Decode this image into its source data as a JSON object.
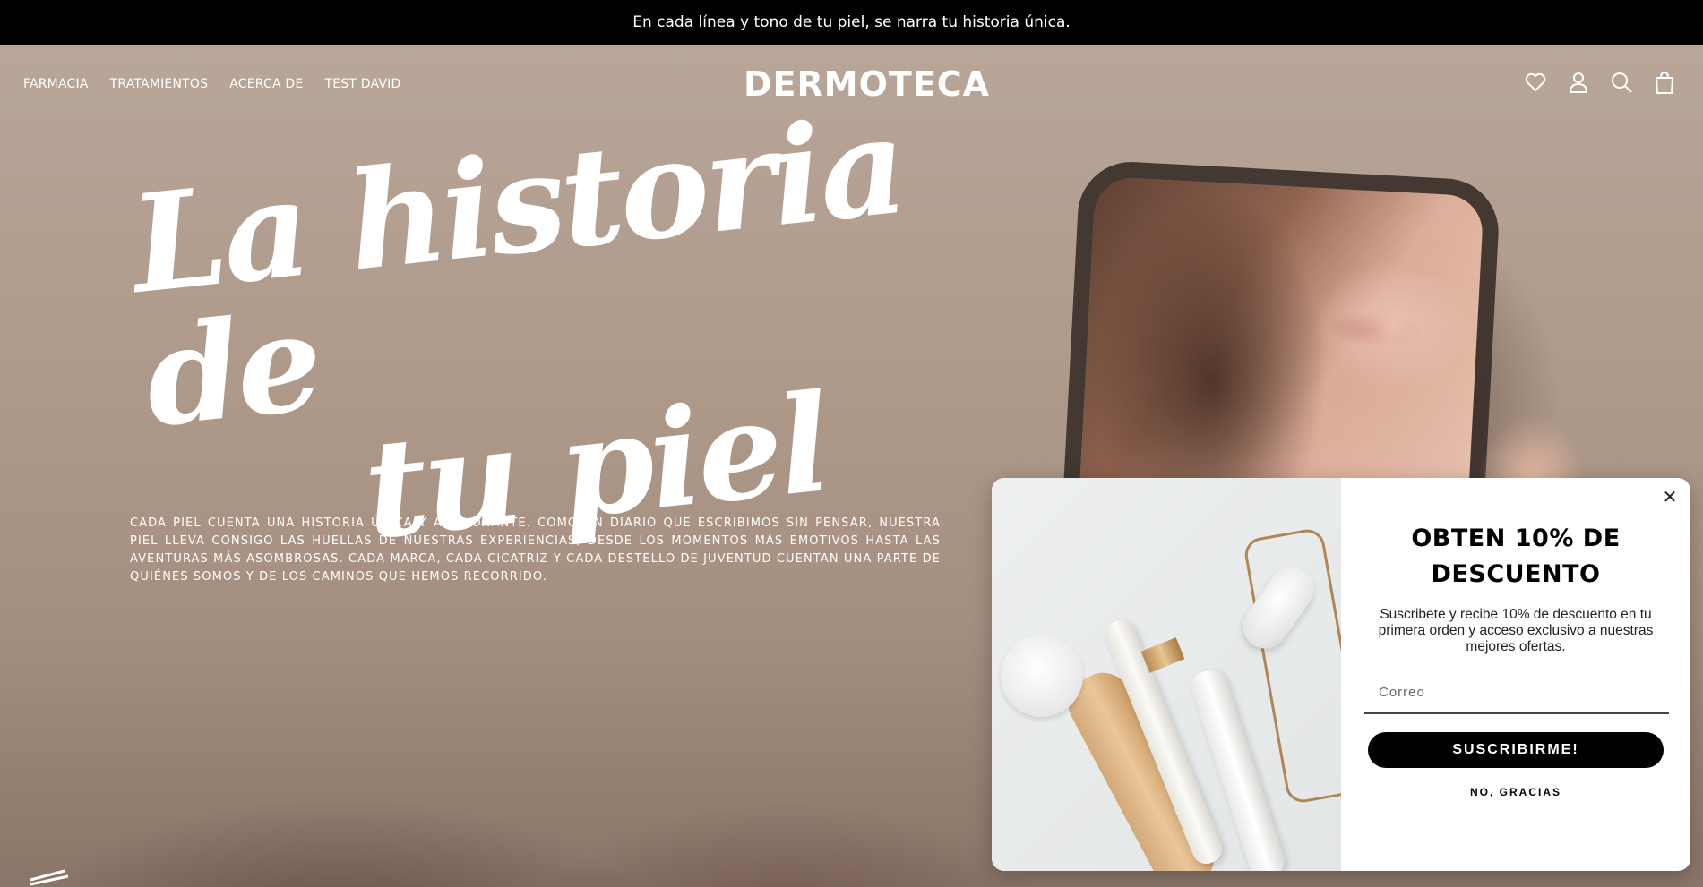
{
  "announcement": {
    "text": "En cada línea y tono de tu piel, se narra tu historia única."
  },
  "header": {
    "nav": [
      {
        "label": "FARMACIA"
      },
      {
        "label": "TRATAMIENTOS"
      },
      {
        "label": "ACERCA DE"
      },
      {
        "label": "TEST DAVID"
      }
    ],
    "logo": "DERMOTECA",
    "icons": [
      "heart-icon",
      "user-icon",
      "search-icon",
      "bag-icon"
    ]
  },
  "hero": {
    "title_line1": "La historia de",
    "title_line2": "tu piel",
    "body": "Cada piel cuenta una historia única y apasionante. Como un diario que escribimos sin pensar, nuestra piel lleva consigo las huellas de nuestras experiencias, desde los momentos más emotivos hasta las aventuras más asombrosas. Cada marca, cada cicatriz y cada destello de juventud cuentan una parte de quiénes somos y de los caminos que hemos recorrido."
  },
  "popup": {
    "close_label": "✕",
    "title": "OBTEN 10% DE DESCUENTO",
    "subtitle": "Suscribete y recibe 10% de descuento en tu primera orden y acceso exclusivo a nuestras mejores ofertas.",
    "email_placeholder": "Correo",
    "subscribe_label": "SUSCRIBIRME!",
    "decline_label": "NO, GRACIAS"
  },
  "colors": {
    "announcement_bg": "#000000",
    "button_bg": "#000000",
    "text_light": "#ffffff"
  }
}
